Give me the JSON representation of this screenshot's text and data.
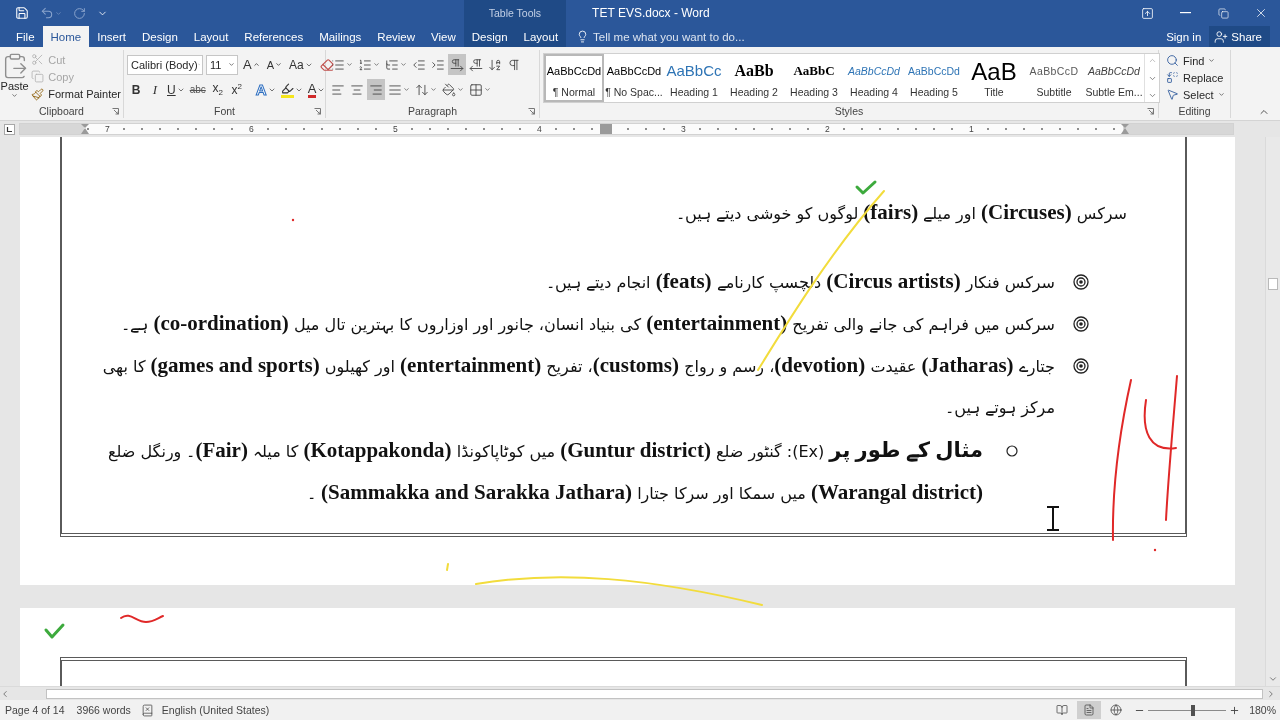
{
  "titlebar": {
    "quick_access": [
      {
        "kind": "save",
        "disabled": false,
        "dropdown": false
      },
      {
        "kind": "undo",
        "disabled": true,
        "dropdown": true
      },
      {
        "kind": "redo",
        "disabled": true,
        "dropdown": false
      },
      {
        "kind": "customize",
        "disabled": false,
        "dropdown": false
      }
    ],
    "context_label": "Table Tools",
    "title": "TET EVS.docx - Word"
  },
  "tabs": [
    {
      "label": "File",
      "selected": false,
      "contextual": false
    },
    {
      "label": "Home",
      "selected": true,
      "contextual": false
    },
    {
      "label": "Insert",
      "selected": false,
      "contextual": false
    },
    {
      "label": "Design",
      "selected": false,
      "contextual": false
    },
    {
      "label": "Layout",
      "selected": false,
      "contextual": false
    },
    {
      "label": "References",
      "selected": false,
      "contextual": false
    },
    {
      "label": "Mailings",
      "selected": false,
      "contextual": false
    },
    {
      "label": "Review",
      "selected": false,
      "contextual": false
    },
    {
      "label": "View",
      "selected": false,
      "contextual": false
    },
    {
      "label": "Design",
      "selected": false,
      "contextual": true
    },
    {
      "label": "Layout",
      "selected": false,
      "contextual": true
    }
  ],
  "tell_me": {
    "placeholder": "Tell me what you want to do..."
  },
  "account": {
    "sign_in": "Sign in",
    "share": "Share"
  },
  "ribbon": {
    "clipboard": {
      "label": "Clipboard",
      "launcher": true,
      "paste": "Paste",
      "items": [
        {
          "kind": "cut",
          "label": "Cut",
          "disabled": true
        },
        {
          "kind": "copy",
          "label": "Copy",
          "disabled": true
        },
        {
          "kind": "painter",
          "label": "Format Painter",
          "disabled": false
        }
      ]
    },
    "font": {
      "label": "Font",
      "launcher": true,
      "name": "Calibri (Body)",
      "size": "11",
      "tools": [
        {
          "kind": "grow",
          "text": "A",
          "dropdown": false
        },
        {
          "kind": "shrink",
          "text": "A",
          "dropdown": false
        },
        {
          "kind": "case",
          "text": "Aa",
          "dropdown": true
        },
        {
          "kind": "clear",
          "dropdown": false
        }
      ],
      "formats": [
        {
          "kind": "bold",
          "text": "B",
          "dropdown": false
        },
        {
          "kind": "italic",
          "text": "I",
          "dropdown": false
        },
        {
          "kind": "underline",
          "text": "U",
          "dropdown": true
        },
        {
          "kind": "strike",
          "text": "abc",
          "dropdown": false
        },
        {
          "kind": "sub",
          "text": "x$_{2}$",
          "dropdown": false
        },
        {
          "kind": "sup",
          "text": "x$^{2}$",
          "dropdown": false
        },
        {
          "kind": "effects",
          "text": "A",
          "dropdown": true
        },
        {
          "kind": "highlight",
          "dropdown": true
        },
        {
          "kind": "color",
          "text": "A",
          "dropdown": true
        }
      ]
    },
    "paragraph": {
      "label": "Paragraph",
      "launcher": true,
      "rows": [
        [
          {
            "kind": "bullets",
            "selected": false,
            "dropdown": true
          },
          {
            "kind": "numbering",
            "selected": false,
            "dropdown": true
          },
          {
            "kind": "multilevel",
            "selected": false,
            "dropdown": true
          },
          {
            "kind": "outdent",
            "selected": false,
            "dropdown": false
          },
          {
            "kind": "indent",
            "selected": false,
            "dropdown": false
          },
          {
            "kind": "ltr",
            "selected": true,
            "dropdown": false
          },
          {
            "kind": "rtl",
            "selected": false,
            "dropdown": false
          },
          {
            "kind": "sort",
            "selected": false,
            "dropdown": false
          },
          {
            "kind": "marks",
            "selected": false,
            "dropdown": false
          }
        ],
        [
          {
            "kind": "left",
            "selected": false,
            "dropdown": false
          },
          {
            "kind": "center",
            "selected": false,
            "dropdown": false
          },
          {
            "kind": "right",
            "selected": true,
            "dropdown": false
          },
          {
            "kind": "justify",
            "selected": false,
            "dropdown": true
          },
          {
            "kind": "spacing",
            "selected": false,
            "dropdown": true
          },
          {
            "kind": "shading",
            "selected": false,
            "dropdown": true
          },
          {
            "kind": "borders",
            "selected": false,
            "dropdown": true
          }
        ]
      ]
    },
    "styles": {
      "label": "Styles",
      "launcher": true,
      "items": [
        {
          "kind": "normal",
          "preview": "AaBbCcDd",
          "name": "¶ Normal",
          "selected": true
        },
        {
          "kind": "normal",
          "preview": "AaBbCcDd",
          "name": "¶ No Spac...",
          "selected": false
        },
        {
          "kind": "heading1",
          "preview": "AaBbCc",
          "name": "Heading 1",
          "selected": false
        },
        {
          "kind": "heading2",
          "preview": "AaBb",
          "name": "Heading 2",
          "selected": false
        },
        {
          "kind": "heading3",
          "preview": "AaBbC",
          "name": "Heading 3",
          "selected": false
        },
        {
          "kind": "heading4",
          "preview": "AaBbCcDd",
          "name": "Heading 4",
          "selected": false
        },
        {
          "kind": "heading5",
          "preview": "AaBbCcDd",
          "name": "Heading 5",
          "selected": false
        },
        {
          "kind": "title",
          "preview": "AaB",
          "name": "Title",
          "selected": false
        },
        {
          "kind": "subtitle",
          "preview": "AaBbCcD",
          "name": "Subtitle",
          "selected": false
        },
        {
          "kind": "emphasis",
          "preview": "AaBbCcDd",
          "name": "Subtle Em...",
          "selected": false
        }
      ]
    },
    "editing": {
      "label": "Editing",
      "launcher": false,
      "items": [
        {
          "kind": "find",
          "label": "Find",
          "dropdown": true
        },
        {
          "kind": "replace",
          "label": "Replace",
          "dropdown": false
        },
        {
          "kind": "select",
          "label": "Select",
          "dropdown": true
        }
      ]
    }
  },
  "ruler": {
    "numbers": [
      "7",
      "6",
      "5",
      "4",
      "3",
      "2",
      "1"
    ]
  },
  "document": {
    "paragraphs": [
      {
        "kind": "plain",
        "text": "سرکس **(Circuses)** اور میلے **(fairs)** لوگوں کو خوشی دیتے ہیں۔"
      },
      {
        "kind": "bullet",
        "text": "سرکس فنکار **(Circus artists)** دلچسپ کارنامے **(feats)** انجام دیتے ہیں۔"
      },
      {
        "kind": "bullet",
        "text": "سرکس میں فراہم کی جانے والی تفریح **(entertainment)** کی بنیاد انسان، جانور اور اوزاروں کا بہترین تال میل **(co-ordination)** ہے۔"
      },
      {
        "kind": "bullet",
        "text": "جتارے **(Jatharas)** عقیدت **(devotion)**، رسم و رواج **(customs)**، تفریح **(entertainment)** اور کھیلوں **(games and sports)** کا بھی مرکز ہوتے ہیں۔"
      },
      {
        "kind": "subbullet",
        "text": "**مثال کے طور پر** (Ex): گنٹور ضلع **(Guntur district)** میں کوٹاپاکونڈا **(Kotappakonda)** کا میلہ **(Fair)**۔ ورنگل ضلع **(Warangal district)** میں سمکا اور سرکا جتارا **(Sammakka and Sarakka Jathara)** ۔"
      }
    ]
  },
  "status_bar": {
    "page": "Page 4 of 14",
    "words": "3966 words",
    "language": "English (United States)",
    "views": [
      {
        "kind": "read",
        "selected": false
      },
      {
        "kind": "print",
        "selected": true
      },
      {
        "kind": "web",
        "selected": false
      }
    ],
    "zoom": {
      "level": 0.58,
      "value": "180%"
    }
  }
}
